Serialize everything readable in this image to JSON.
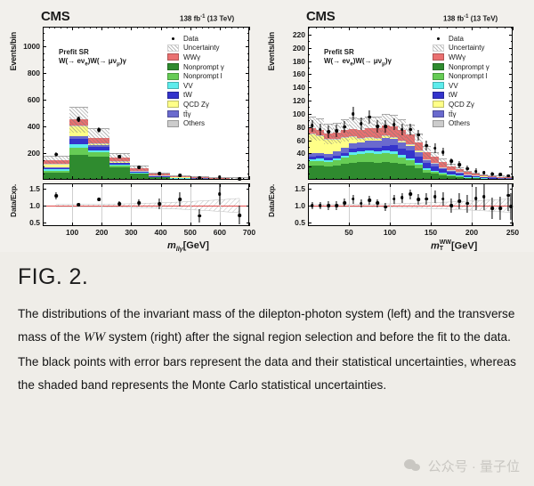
{
  "figure": {
    "title": "FIG. 2.",
    "caption": "The distributions of the invariant mass of the dilepton-photon system (left) and the transverse mass of the WW system (right) after the signal region selection and before the fit to the data. The black points with error bars represent the data and their statistical uncertainties, whereas the shaded band represents the Monte Carlo statistical uncertainties.",
    "caption_parts": {
      "p1": "The distributions of the invariant mass of the dilepton-photon system (left) and the transverse mass of the ",
      "italic1": "WW",
      "p2": " system (right) after the signal region selection and before the fit to the data. The black points with error bars represent the data and their statistical uncertainties, whereas the shaded band represents the Monte Carlo statistical uncertainties."
    }
  },
  "watermark": {
    "text": "公众号 · 量子位",
    "icon": "wechat-icon"
  },
  "palette": {
    "WWgamma": "#ea7070",
    "NonpromptGamma": "#2f8b2f",
    "NonpromptL": "#66cc55",
    "VV": "#5cecec",
    "tW": "#3434cc",
    "QCDZgamma": "#ffff88",
    "ttgamma": "#6a6ace",
    "Others": "#cccccc",
    "Data": "#000000",
    "Uncertainty": "#b9b9b9",
    "refline": "#e04b4b"
  },
  "legend": [
    {
      "label": "Data",
      "style": "data"
    },
    {
      "label": "Uncertainty",
      "style": "hatch"
    },
    {
      "label": "WWγ",
      "style": "fill",
      "color": "#ea7070"
    },
    {
      "label": "Nonprompt γ",
      "style": "fill",
      "color": "#2f8b2f"
    },
    {
      "label": "Nonprompt l",
      "style": "fill",
      "color": "#66cc55"
    },
    {
      "label": "VV",
      "style": "fill",
      "color": "#5cecec"
    },
    {
      "label": "tW",
      "style": "fill",
      "color": "#3434cc"
    },
    {
      "label": "QCD Zγ",
      "style": "fill",
      "color": "#ffff88"
    },
    {
      "label": "tt̄γ",
      "style": "fill",
      "color": "#6a6ace"
    },
    {
      "label": "Others",
      "style": "fill",
      "color": "#cccccc"
    }
  ],
  "chart_data": [
    {
      "id": "left",
      "type": "bar",
      "stacked": true,
      "experiment": "CMS",
      "lumi": "138 fb",
      "lumi_sup": "-1",
      "lumi_energy": "(13 TeV)",
      "annotation_line1": "Prefit SR",
      "annotation_line2": "W(→ eνe)W(→ μνμ)γ",
      "title": "",
      "xlabel": "m_{llγ} [GeV]",
      "xlabel_base": "m",
      "xlabel_sub": "llγ",
      "xlabel_unit": "[GeV]",
      "ylabel": "Events/bin",
      "ratio_ylabel": "Data/Exp.",
      "xlim": [
        0,
        700
      ],
      "ylim": [
        0,
        1150
      ],
      "ratio_ylim": [
        0.4,
        1.65
      ],
      "xticks": [
        100,
        200,
        300,
        400,
        500,
        600,
        700
      ],
      "yticks": [
        200,
        400,
        600,
        800,
        1000
      ],
      "ratio_yticks": [
        0.5,
        1.0,
        1.5
      ],
      "bin_edges": [
        0,
        90,
        155,
        225,
        295,
        360,
        430,
        500,
        565,
        635,
        700
      ],
      "bin_centers": [
        45,
        122,
        190,
        260,
        327,
        395,
        465,
        532,
        600,
        667
      ],
      "series": [
        {
          "name": "Nonprompt γ",
          "color": "#2f8b2f",
          "values": [
            52,
            185,
            175,
            95,
            48,
            22,
            13,
            8,
            6,
            4
          ]
        },
        {
          "name": "Nonprompt l",
          "color": "#66cc55",
          "values": [
            18,
            55,
            30,
            12,
            6,
            3,
            2,
            1,
            1,
            1
          ]
        },
        {
          "name": "VV",
          "color": "#5cecec",
          "values": [
            8,
            25,
            14,
            6,
            3,
            2,
            1,
            1,
            1,
            0.5
          ]
        },
        {
          "name": "tW",
          "color": "#3434cc",
          "values": [
            12,
            40,
            27,
            12,
            6,
            3,
            2,
            1,
            1,
            1
          ]
        },
        {
          "name": "tt̄γ",
          "color": "#6a6ace",
          "values": [
            6,
            22,
            15,
            7,
            4,
            2,
            1,
            1,
            1,
            0.5
          ]
        },
        {
          "name": "QCD Zγ",
          "color": "#ffff88",
          "values": [
            22,
            72,
            10,
            4,
            2,
            1,
            1,
            0.5,
            0.5,
            0.5
          ]
        },
        {
          "name": "Others",
          "color": "#cccccc",
          "values": [
            4,
            8,
            5,
            2,
            1,
            1,
            0.5,
            0.5,
            0.5,
            0.5
          ]
        },
        {
          "name": "WWγ",
          "color": "#ea7070",
          "values": [
            28,
            45,
            40,
            28,
            16,
            10,
            7,
            4,
            3,
            2
          ]
        }
      ],
      "totals": [
        150,
        452,
        316,
        166,
        86,
        44,
        27,
        17,
        14,
        10
      ],
      "data_points": [
        {
          "x": 45,
          "y": 190,
          "err": 14
        },
        {
          "x": 122,
          "y": 455,
          "err": 21
        },
        {
          "x": 190,
          "y": 375,
          "err": 19
        },
        {
          "x": 260,
          "y": 175,
          "err": 13
        },
        {
          "x": 327,
          "y": 92,
          "err": 10
        },
        {
          "x": 395,
          "y": 47,
          "err": 7
        },
        {
          "x": 465,
          "y": 32,
          "err": 6
        },
        {
          "x": 532,
          "y": 12,
          "err": 4
        },
        {
          "x": 600,
          "y": 19,
          "err": 4
        },
        {
          "x": 667,
          "y": 7,
          "err": 3
        }
      ],
      "ratio_points": [
        {
          "x": 45,
          "y": 1.28,
          "err": 0.1
        },
        {
          "x": 122,
          "y": 1.02,
          "err": 0.05
        },
        {
          "x": 190,
          "y": 1.18,
          "err": 0.06
        },
        {
          "x": 260,
          "y": 1.05,
          "err": 0.08
        },
        {
          "x": 327,
          "y": 1.07,
          "err": 0.11
        },
        {
          "x": 395,
          "y": 1.05,
          "err": 0.16
        },
        {
          "x": 465,
          "y": 1.18,
          "err": 0.21
        },
        {
          "x": 532,
          "y": 0.7,
          "err": 0.2
        },
        {
          "x": 600,
          "y": 1.34,
          "err": 0.31
        },
        {
          "x": 667,
          "y": 0.72,
          "err": 0.27
        }
      ]
    },
    {
      "id": "right",
      "type": "bar",
      "stacked": true,
      "experiment": "CMS",
      "lumi": "138 fb",
      "lumi_sup": "-1",
      "lumi_energy": "(13 TeV)",
      "annotation_line1": "Prefit SR",
      "annotation_line2": "W(→ eνe)W(→ μνμ)γ",
      "title": "",
      "xlabel": "m_T^{WW} [GeV]",
      "xlabel_base": "m",
      "xlabel_sub": "T",
      "xlabel_sup": "WW",
      "xlabel_unit": "[GeV]",
      "ylabel": "Events/bin",
      "ratio_ylabel": "Data/Exp.",
      "xlim": [
        0,
        250
      ],
      "ylim": [
        0,
        232
      ],
      "ratio_ylim": [
        0.4,
        1.65
      ],
      "xticks": [
        50,
        100,
        150,
        200,
        250
      ],
      "yticks": [
        20,
        40,
        60,
        80,
        100,
        120,
        140,
        160,
        180,
        200,
        220
      ],
      "ratio_yticks": [
        0.5,
        1.0,
        1.5
      ],
      "bin_width": 10,
      "bin_centers": [
        5,
        15,
        25,
        35,
        45,
        55,
        65,
        75,
        85,
        95,
        105,
        115,
        125,
        135,
        145,
        155,
        165,
        175,
        185,
        195,
        205,
        215,
        225,
        235,
        245
      ],
      "series": [
        {
          "name": "Nonprompt γ",
          "color": "#2f8b2f",
          "values": [
            22,
            22,
            20,
            22,
            24,
            26,
            27,
            27,
            26,
            27,
            26,
            24,
            22,
            17,
            11,
            9,
            7,
            5,
            4,
            3,
            2.5,
            2,
            1.5,
            1,
            1
          ]
        },
        {
          "name": "Nonprompt l",
          "color": "#66cc55",
          "values": [
            6,
            7,
            7,
            8,
            10,
            12,
            12,
            13,
            13,
            14,
            13,
            10,
            8,
            6,
            4,
            3,
            2.5,
            2,
            1.5,
            1,
            1,
            0.8,
            0.6,
            0.5,
            0.4
          ]
        },
        {
          "name": "VV",
          "color": "#5cecec",
          "values": [
            3,
            3,
            3,
            3,
            3,
            4,
            4,
            4,
            4,
            4,
            4,
            3.5,
            3,
            2.5,
            2,
            1.5,
            1.2,
            1,
            0.8,
            0.6,
            0.5,
            0.4,
            0.3,
            0.3,
            0.2
          ]
        },
        {
          "name": "tW",
          "color": "#3434cc",
          "values": [
            4,
            4,
            4,
            4,
            4,
            5,
            5,
            5,
            5,
            6,
            9,
            10,
            11,
            10,
            8,
            7,
            5,
            4,
            3,
            2,
            1.5,
            1.2,
            1,
            0.8,
            0.6
          ]
        },
        {
          "name": "tt̄γ",
          "color": "#6a6ace",
          "values": [
            5,
            5,
            5,
            6,
            7,
            8,
            9,
            10,
            11,
            12,
            10,
            9,
            8,
            7,
            5,
            4,
            3,
            2.5,
            2,
            1.5,
            1.2,
            1,
            0.8,
            0.6,
            0.5
          ]
        },
        {
          "name": "QCD Zγ",
          "color": "#ffff88",
          "values": [
            29,
            26,
            22,
            18,
            16,
            10,
            6,
            5,
            4,
            3,
            2,
            1.5,
            1.2,
            1,
            0.8,
            0.6,
            0.5,
            0.4,
            0.3,
            0.2,
            0.2,
            0.2,
            0.1,
            0.1,
            0.1
          ]
        },
        {
          "name": "Others",
          "color": "#cccccc",
          "values": [
            1,
            1,
            1,
            1,
            1,
            1,
            1,
            1,
            1,
            1,
            1,
            1,
            0.8,
            0.6,
            0.5,
            0.4,
            0.3,
            0.3,
            0.2,
            0.2,
            0.2,
            0.1,
            0.1,
            0.1,
            0.1
          ]
        },
        {
          "name": "WWγ",
          "color": "#ea7070",
          "values": [
            8,
            8,
            8,
            9,
            10,
            11,
            12,
            13,
            14,
            15,
            16,
            16,
            15,
            13,
            11,
            9,
            7,
            5,
            4,
            3,
            2,
            1.5,
            1.2,
            1,
            0.8
          ]
        }
      ],
      "totals": [
        78,
        76,
        70,
        71,
        75,
        77,
        76,
        78,
        78,
        82,
        81,
        75,
        69,
        57,
        42,
        34,
        26,
        20,
        15,
        11,
        9,
        7,
        5.5,
        4.4,
        3.7
      ],
      "data_points": [
        {
          "x": 5,
          "y": 82,
          "err": 9
        },
        {
          "x": 15,
          "y": 76,
          "err": 9
        },
        {
          "x": 25,
          "y": 73,
          "err": 9
        },
        {
          "x": 35,
          "y": 74,
          "err": 9
        },
        {
          "x": 45,
          "y": 80,
          "err": 9
        },
        {
          "x": 55,
          "y": 100,
          "err": 10
        },
        {
          "x": 65,
          "y": 85,
          "err": 9
        },
        {
          "x": 75,
          "y": 95,
          "err": 10
        },
        {
          "x": 85,
          "y": 81,
          "err": 9
        },
        {
          "x": 95,
          "y": 81,
          "err": 9
        },
        {
          "x": 105,
          "y": 84,
          "err": 9
        },
        {
          "x": 115,
          "y": 76,
          "err": 9
        },
        {
          "x": 125,
          "y": 76,
          "err": 9
        },
        {
          "x": 135,
          "y": 68,
          "err": 8
        },
        {
          "x": 145,
          "y": 52,
          "err": 7
        },
        {
          "x": 155,
          "y": 48,
          "err": 7
        },
        {
          "x": 165,
          "y": 42,
          "err": 6
        },
        {
          "x": 175,
          "y": 28,
          "err": 5
        },
        {
          "x": 185,
          "y": 23,
          "err": 5
        },
        {
          "x": 195,
          "y": 17,
          "err": 4
        },
        {
          "x": 205,
          "y": 13,
          "err": 4
        },
        {
          "x": 215,
          "y": 11,
          "err": 3
        },
        {
          "x": 225,
          "y": 9,
          "err": 3
        },
        {
          "x": 235,
          "y": 8,
          "err": 3
        },
        {
          "x": 245,
          "y": 6,
          "err": 2
        }
      ],
      "ratio_points": [
        {
          "x": 5,
          "y": 1.0,
          "err": 0.11
        },
        {
          "x": 15,
          "y": 1.0,
          "err": 0.11
        },
        {
          "x": 25,
          "y": 1.0,
          "err": 0.12
        },
        {
          "x": 35,
          "y": 1.0,
          "err": 0.12
        },
        {
          "x": 45,
          "y": 1.08,
          "err": 0.12
        },
        {
          "x": 55,
          "y": 1.19,
          "err": 0.13
        },
        {
          "x": 65,
          "y": 1.06,
          "err": 0.12
        },
        {
          "x": 75,
          "y": 1.16,
          "err": 0.13
        },
        {
          "x": 85,
          "y": 1.07,
          "err": 0.12
        },
        {
          "x": 95,
          "y": 0.96,
          "err": 0.11
        },
        {
          "x": 105,
          "y": 1.19,
          "err": 0.13
        },
        {
          "x": 115,
          "y": 1.23,
          "err": 0.14
        },
        {
          "x": 125,
          "y": 1.33,
          "err": 0.15
        },
        {
          "x": 135,
          "y": 1.18,
          "err": 0.15
        },
        {
          "x": 145,
          "y": 1.19,
          "err": 0.17
        },
        {
          "x": 155,
          "y": 1.26,
          "err": 0.19
        },
        {
          "x": 165,
          "y": 1.19,
          "err": 0.19
        },
        {
          "x": 175,
          "y": 1.0,
          "err": 0.2
        },
        {
          "x": 185,
          "y": 1.13,
          "err": 0.24
        },
        {
          "x": 195,
          "y": 1.06,
          "err": 0.26
        },
        {
          "x": 205,
          "y": 1.21,
          "err": 0.33
        },
        {
          "x": 215,
          "y": 1.26,
          "err": 0.38
        },
        {
          "x": 225,
          "y": 0.92,
          "err": 0.31
        },
        {
          "x": 235,
          "y": 0.92,
          "err": 0.33
        },
        {
          "x": 245,
          "y": 1.3,
          "err": 0.45
        },
        {
          "x": 248,
          "y": 0.97,
          "err": 0.4
        }
      ]
    }
  ]
}
